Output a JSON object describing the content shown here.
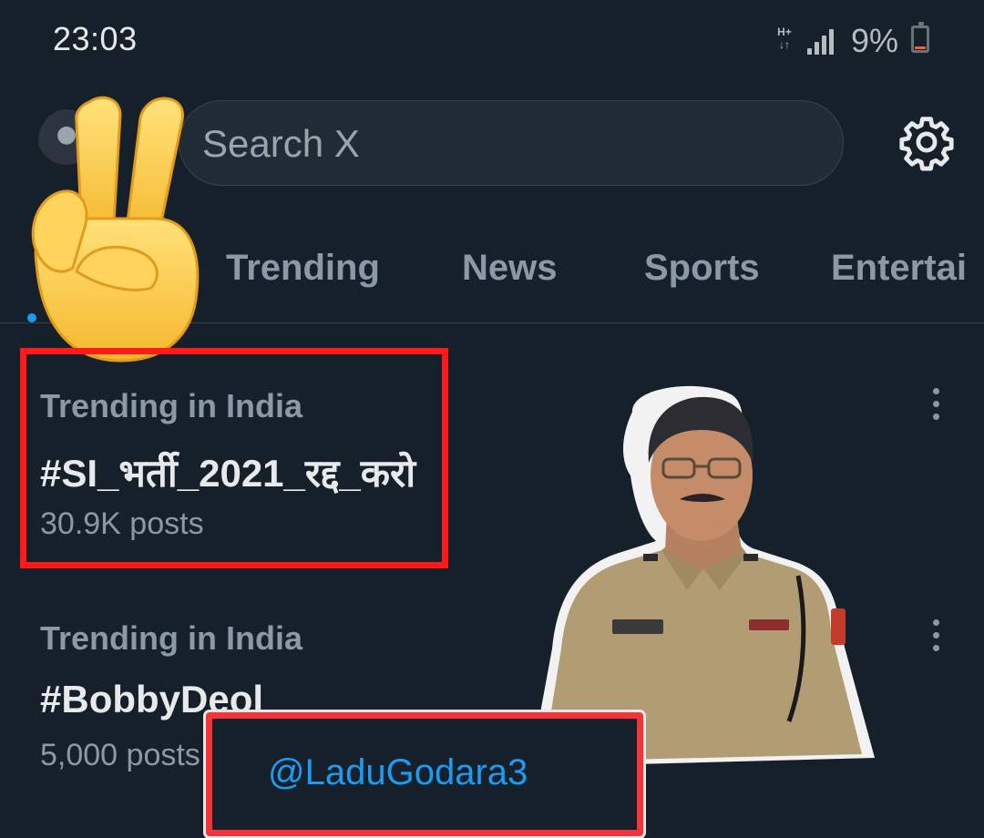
{
  "status_bar": {
    "time": "23:03",
    "network": "H+",
    "battery_percent": "9%",
    "battery_level": 0.09
  },
  "header": {
    "search_placeholder": "Search X",
    "settings_icon": "gear-icon"
  },
  "tabs": [
    {
      "label": "Trending"
    },
    {
      "label": "News"
    },
    {
      "label": "Sports"
    },
    {
      "label": "Entertai"
    }
  ],
  "trends": [
    {
      "context": "Trending in India",
      "name": "#SI_भर्ती_2021_रद्द_करो",
      "posts": "30.9K posts"
    },
    {
      "context": "Trending in India",
      "name": "#BobbyDeol",
      "posts": "5,000 posts"
    }
  ],
  "overlay": {
    "handle": "@LaduGodara3",
    "sticker_emoji": "victory-hand",
    "highlight_color": "#ff1a1a",
    "handle_color": "#1d9bf0"
  },
  "colors": {
    "background": "#15202b",
    "accent": "#1d9bf0",
    "muted_text": "#8b98a5"
  }
}
